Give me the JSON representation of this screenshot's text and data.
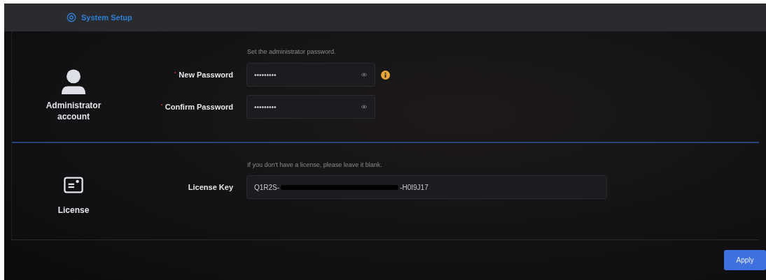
{
  "header": {
    "title": "System Setup"
  },
  "sections": [
    {
      "title": "Administrator account",
      "hint": "Set the administrator password.",
      "fields": [
        {
          "label": "New Password",
          "required": true,
          "value": "•••••••••",
          "kind": "password",
          "info": true
        },
        {
          "label": "Confirm Password",
          "required": true,
          "value": "•••••••••",
          "kind": "password",
          "info": false
        }
      ]
    },
    {
      "title": "License",
      "hint": "If you don't have a license, please leave it blank.",
      "fields": [
        {
          "label": "License Key",
          "required": false,
          "value_start": "Q1R2S-",
          "value_end": "-H0I9J17",
          "redacted": true,
          "kind": "text",
          "info": false
        }
      ]
    }
  ],
  "apply_button": "Apply"
}
